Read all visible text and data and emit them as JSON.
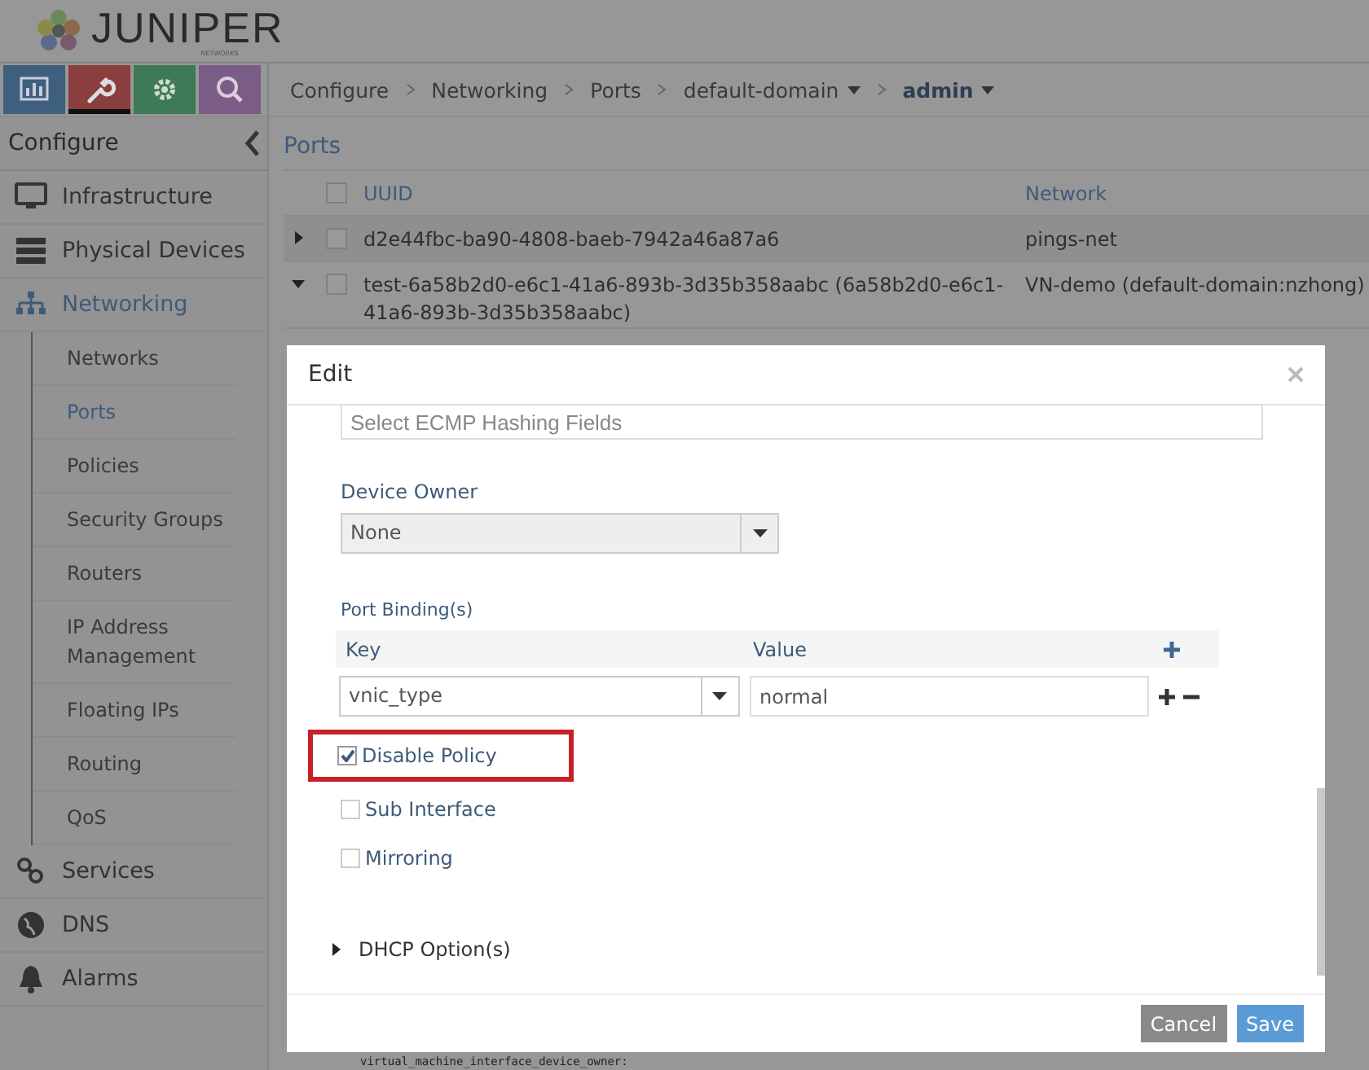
{
  "logo": {
    "text": "JUNIPER",
    "subtext": "NETWORKS"
  },
  "nav_buttons": [
    {
      "kind": "monitor",
      "selected": false
    },
    {
      "kind": "configure",
      "selected": true
    },
    {
      "kind": "settings",
      "selected": false
    },
    {
      "kind": "search",
      "selected": false
    }
  ],
  "breadcrumb": [
    {
      "label": "Configure",
      "dropdown": false,
      "selected": false
    },
    {
      "label": "Networking",
      "dropdown": false,
      "selected": false
    },
    {
      "label": "Ports",
      "dropdown": false,
      "selected": false
    },
    {
      "label": "default-domain",
      "dropdown": true,
      "selected": false
    },
    {
      "label": "admin",
      "dropdown": true,
      "selected": true
    }
  ],
  "sidebar": {
    "title": "Configure",
    "items": [
      {
        "label": "Infrastructure",
        "kind": "monitor",
        "selected": false
      },
      {
        "label": "Physical Devices",
        "kind": "server",
        "selected": false
      },
      {
        "label": "Networking",
        "kind": "network",
        "selected": true,
        "children": [
          {
            "label": "Networks",
            "selected": false
          },
          {
            "label": "Ports",
            "selected": true
          },
          {
            "label": "Policies",
            "selected": false
          },
          {
            "label": "Security Groups",
            "selected": false
          },
          {
            "label": "Routers",
            "selected": false
          },
          {
            "label": "IP Address Management",
            "selected": false
          },
          {
            "label": "Floating IPs",
            "selected": false
          },
          {
            "label": "Routing",
            "selected": false
          },
          {
            "label": "QoS",
            "selected": false
          }
        ]
      },
      {
        "label": "Services",
        "kind": "link",
        "selected": false
      },
      {
        "label": "DNS",
        "kind": "globe",
        "selected": false
      },
      {
        "label": "Alarms",
        "kind": "bell",
        "selected": false
      }
    ]
  },
  "ports": {
    "title": "Ports",
    "columns": [
      "UUID",
      "Network"
    ],
    "header_checked": false,
    "rows": [
      {
        "expanded": false,
        "checked": false,
        "uuid": "d2e44fbc-ba90-4808-baeb-7942a46a87a6",
        "network": "pings-net"
      },
      {
        "expanded": true,
        "checked": false,
        "uuid": "test-6a58b2d0-e6c1-41a6-893b-3d35b358aabc (6a58b2d0-e6c1-41a6-893b-3d35b358aabc)",
        "network": "VN-demo (default-domain:nzhong)"
      }
    ]
  },
  "modal": {
    "title": "Edit",
    "ecmp_placeholder": "Select ECMP Hashing Fields",
    "device_owner": {
      "label": "Device Owner",
      "value": "None",
      "disabled": true
    },
    "port_bindings": {
      "label": "Port Binding(s)",
      "columns": [
        "Key",
        "Value"
      ],
      "rows": [
        {
          "key": "vnic_type",
          "value": "normal"
        }
      ]
    },
    "checkboxes": [
      {
        "label": "Disable Policy",
        "checked": true,
        "highlighted": true
      },
      {
        "label": "Sub Interface",
        "checked": false,
        "highlighted": false
      },
      {
        "label": "Mirroring",
        "checked": false,
        "highlighted": false
      }
    ],
    "dhcp": {
      "label": "DHCP Option(s)",
      "expanded": false
    },
    "buttons": [
      {
        "label": "Cancel",
        "kind": "secondary"
      },
      {
        "label": "Save",
        "kind": "primary"
      }
    ]
  },
  "background_text": "virtual_machine_interface_device_owner:"
}
